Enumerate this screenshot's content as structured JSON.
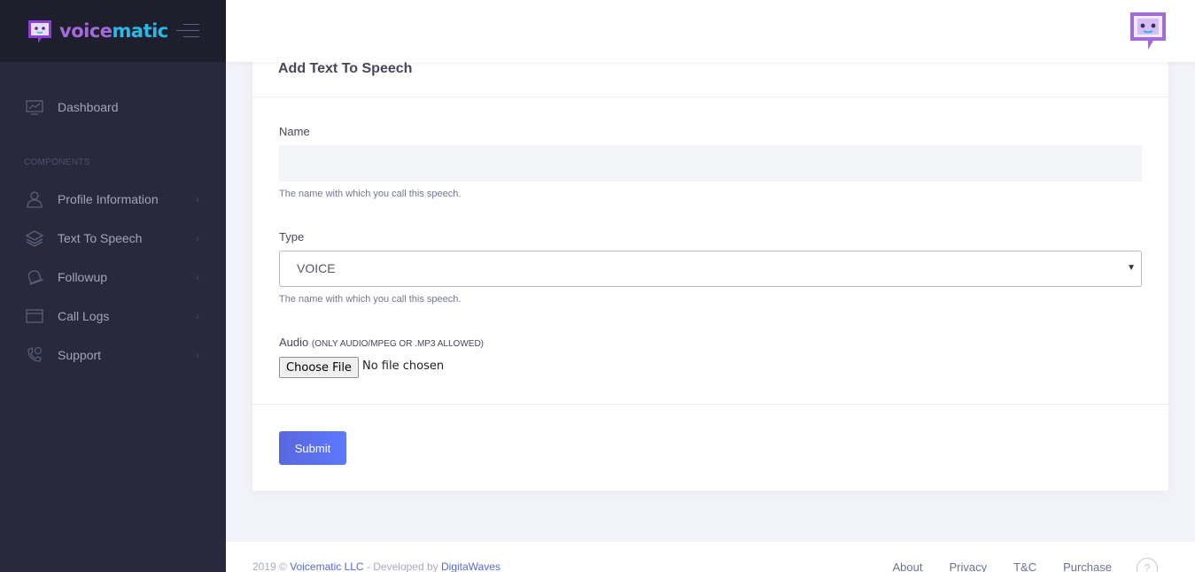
{
  "brand": {
    "part1": "voice",
    "part2": "matic"
  },
  "sidebar": {
    "dashboard": "Dashboard",
    "section_title": "COMPONENTS",
    "items": [
      {
        "label": "Profile Information",
        "icon": "user-icon"
      },
      {
        "label": "Text To Speech",
        "icon": "layers-icon"
      },
      {
        "label": "Followup",
        "icon": "bell-icon"
      },
      {
        "label": "Call Logs",
        "icon": "window-icon"
      },
      {
        "label": "Support",
        "icon": "phone-icon"
      }
    ]
  },
  "form": {
    "title": "Add Text To Speech",
    "name_label": "Name",
    "name_value": "",
    "name_hint": "The name with which you call this speech.",
    "type_label": "Type",
    "type_value": "VOICE",
    "type_hint": "The name with which you call this speech.",
    "audio_label": "Audio",
    "audio_note": "(ONLY AUDIO/MPEG OR .MP3 ALLOWED)",
    "file_button": "Choose File",
    "file_status": "No file chosen",
    "submit": "Submit"
  },
  "footer": {
    "year": "2019 ©",
    "company": "Voicematic LLC",
    "dev_text": "- Developed by",
    "developer": "DigitaWaves",
    "links": [
      "About",
      "Privacy",
      "T&C",
      "Purchase"
    ],
    "help": "?"
  },
  "colors": {
    "primary": "#5867dd",
    "sidebar_bg": "#282a3c",
    "brand_purple": "#a26bd9",
    "brand_cyan": "#2ab8e6"
  }
}
